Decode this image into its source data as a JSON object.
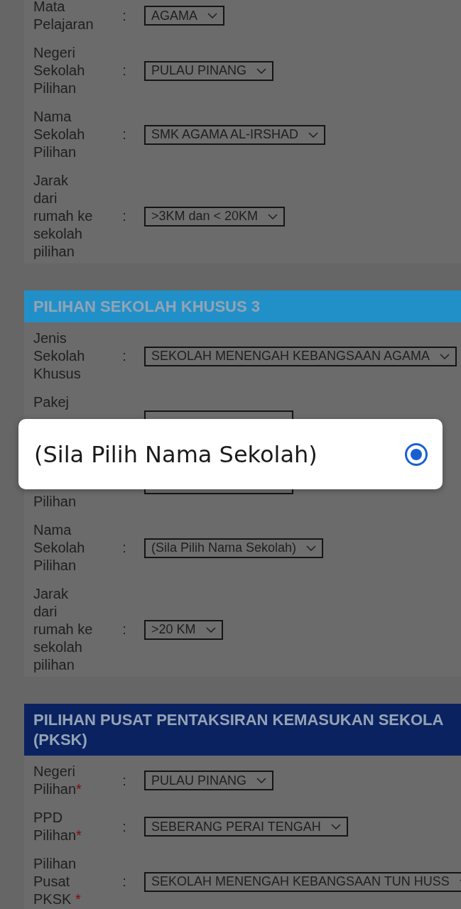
{
  "sections": [
    {
      "rows": [
        {
          "label": "Mata Pelajaran",
          "separator": ":",
          "value": "AGAMA"
        },
        {
          "label": "Negeri Sekolah Pilihan",
          "separator": ":",
          "value": "PULAU PINANG"
        },
        {
          "label": "Nama Sekolah Pilihan",
          "separator": ":",
          "value": "SMK AGAMA AL-IRSHAD"
        },
        {
          "label": "Jarak dari rumah ke sekolah pilihan",
          "separator": ":",
          "value": ">3KM dan < 20KM"
        }
      ]
    },
    {
      "title_lines": [
        "PILIHAN SEKOLAH KHUSUS 3"
      ],
      "color": "#2290c8",
      "rows": [
        {
          "label": "Jenis Sekolah Khusus",
          "separator": ":",
          "value": "SEKOLAH MENENGAH KEBANGSAAN AGAMA"
        },
        {
          "kind": "covered_top",
          "label": "Pakej"
        },
        {
          "kind": "covered_bottom",
          "label": "Pilihan"
        },
        {
          "label": "Nama Sekolah Pilihan",
          "separator": ":",
          "value": "(Sila Pilih Nama Sekolah)"
        },
        {
          "label": "Jarak dari rumah ke sekolah pilihan",
          "separator": ":",
          "value": ">20 KM"
        }
      ]
    },
    {
      "title_lines": [
        "PILIHAN PUSAT PENTAKSIRAN KEMASUKAN SEKOLA",
        "(PKSK)"
      ],
      "color": "#0b2260",
      "rows": [
        {
          "label": "Negeri Pilihan",
          "mark": "*",
          "separator": ":",
          "value": "PULAU PINANG"
        },
        {
          "label": "PPD Pilihan",
          "mark": "*",
          "separator": ":",
          "value": "SEBERANG PERAI TENGAH"
        },
        {
          "label": "Pilihan Pusat PKSK",
          "mark": " *",
          "separator": ":",
          "value": "SEKOLAH MENENGAH KEBANGSAAN TUN HUSS"
        }
      ]
    }
  ],
  "dialog": {
    "options": [
      {
        "label": "(Sila Pilih Nama Sekolah)",
        "selected": true
      }
    ]
  }
}
